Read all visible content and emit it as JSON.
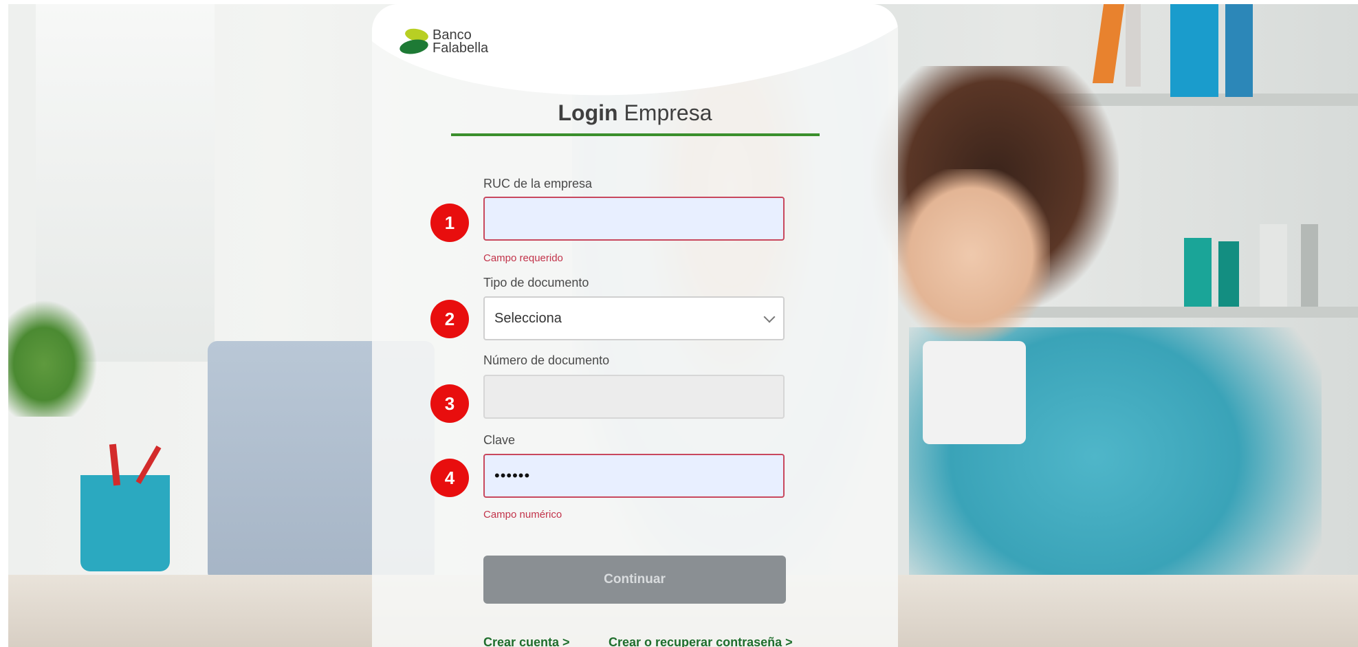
{
  "brand": {
    "line1": "Banco",
    "line2": "Falabella"
  },
  "title": {
    "bold": "Login",
    "regular": "Empresa"
  },
  "form": {
    "ruc": {
      "label": "RUC de la empresa",
      "value": "",
      "error": "Campo requerido",
      "step": "1"
    },
    "doc_type": {
      "label": "Tipo de documento",
      "selected": "Selecciona",
      "step": "2"
    },
    "doc_number": {
      "label": "Número de documento",
      "value": "",
      "step": "3"
    },
    "password": {
      "label": "Clave",
      "value": "••••••",
      "error": "Campo numérico",
      "step": "4"
    },
    "submit_label": "Continuar"
  },
  "links": {
    "create_account": "Crear cuenta >",
    "recover_password": "Crear o recuperar contraseña >"
  },
  "colors": {
    "accent_green": "#3a8f2c",
    "error_red": "#c2334a",
    "badge_red": "#e80e0e",
    "button_gray": "#8a8f93"
  }
}
